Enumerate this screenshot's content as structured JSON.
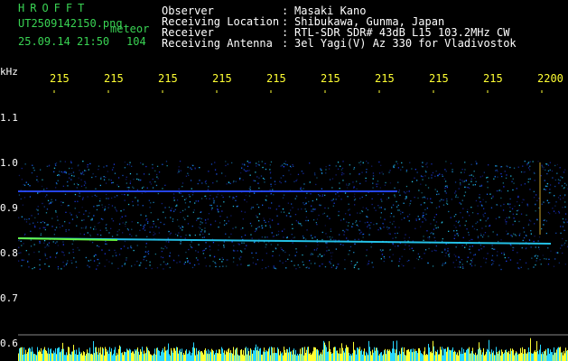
{
  "header": {
    "app_title": "HROFFT",
    "file_name": "UT2509142150.png",
    "file_tag": "meteor",
    "datetime": "25.09.14 21:50",
    "count": "104",
    "meta": [
      {
        "label": "Observer",
        "sep": ":",
        "value": "Masaki Kano"
      },
      {
        "label": "Receiving Location",
        "sep": ":",
        "value": "Shibukawa, Gunma, Japan"
      },
      {
        "label": "Receiver",
        "sep": ":",
        "value": "RTL-SDR SDR# 43dB L15 103.2MHz CW"
      },
      {
        "label": "Receiving Antenna",
        "sep": ":",
        "value": "3el Yagi(V) Az 330 for Vladivostok"
      }
    ]
  },
  "axes": {
    "y_unit": "kHz",
    "x_ticks": [
      "215",
      "215",
      "215",
      "215",
      "215",
      "215",
      "215",
      "215",
      "215",
      "2200"
    ],
    "y_ticks": [
      "1.1",
      "1.0",
      "0.9",
      "0.8",
      "0.7",
      "0.6"
    ]
  },
  "colors": {
    "background": "#000000",
    "header_green": "#39d353",
    "tick_yellow": "#ffff33",
    "signal_blue": "#1e3cff",
    "signal_cyan": "#28d6ff",
    "meteor_green": "#6cff3a"
  }
}
